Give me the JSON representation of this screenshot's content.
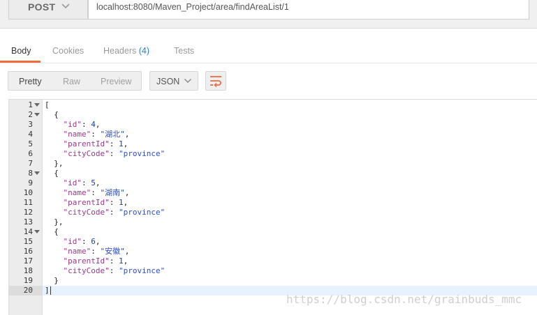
{
  "request": {
    "method": "POST",
    "url": "localhost:8080/Maven_Project/area/findAreaList/1"
  },
  "tabs": [
    {
      "label": "Body"
    },
    {
      "label": "Cookies"
    },
    {
      "label": "Headers",
      "count": "(4)"
    },
    {
      "label": "Tests"
    }
  ],
  "toolbar": {
    "views": [
      "Pretty",
      "Raw",
      "Preview"
    ],
    "format": "JSON"
  },
  "editor": {
    "lines": [
      "[",
      "  {",
      "    \"id\": 4,",
      "    \"name\": \"湖北\",",
      "    \"parentId\": 1,",
      "    \"cityCode\": \"province\"",
      "  },",
      "  {",
      "    \"id\": 5,",
      "    \"name\": \"湖南\",",
      "    \"parentId\": 1,",
      "    \"cityCode\": \"province\"",
      "  },",
      "  {",
      "    \"id\": 6,",
      "    \"name\": \"安徽\",",
      "    \"parentId\": 1,",
      "    \"cityCode\": \"province\"",
      "  }",
      "]"
    ],
    "fold_lines": [
      1,
      2,
      8,
      14
    ]
  },
  "watermark": "https://blog.csdn.net/grainbuds_mmc",
  "colors": {
    "active_tab": "#f26b3a",
    "header_count": "#2b7fd4",
    "json_key": "#9a3b8a",
    "json_string": "#2a4ec9",
    "wrap_icon": "#f26b3a"
  },
  "icons": {
    "method": "chevron-down-icon",
    "format": "chevron-down-icon",
    "wrap": "wrap-lines-icon",
    "fold": "fold-arrow-icon"
  }
}
